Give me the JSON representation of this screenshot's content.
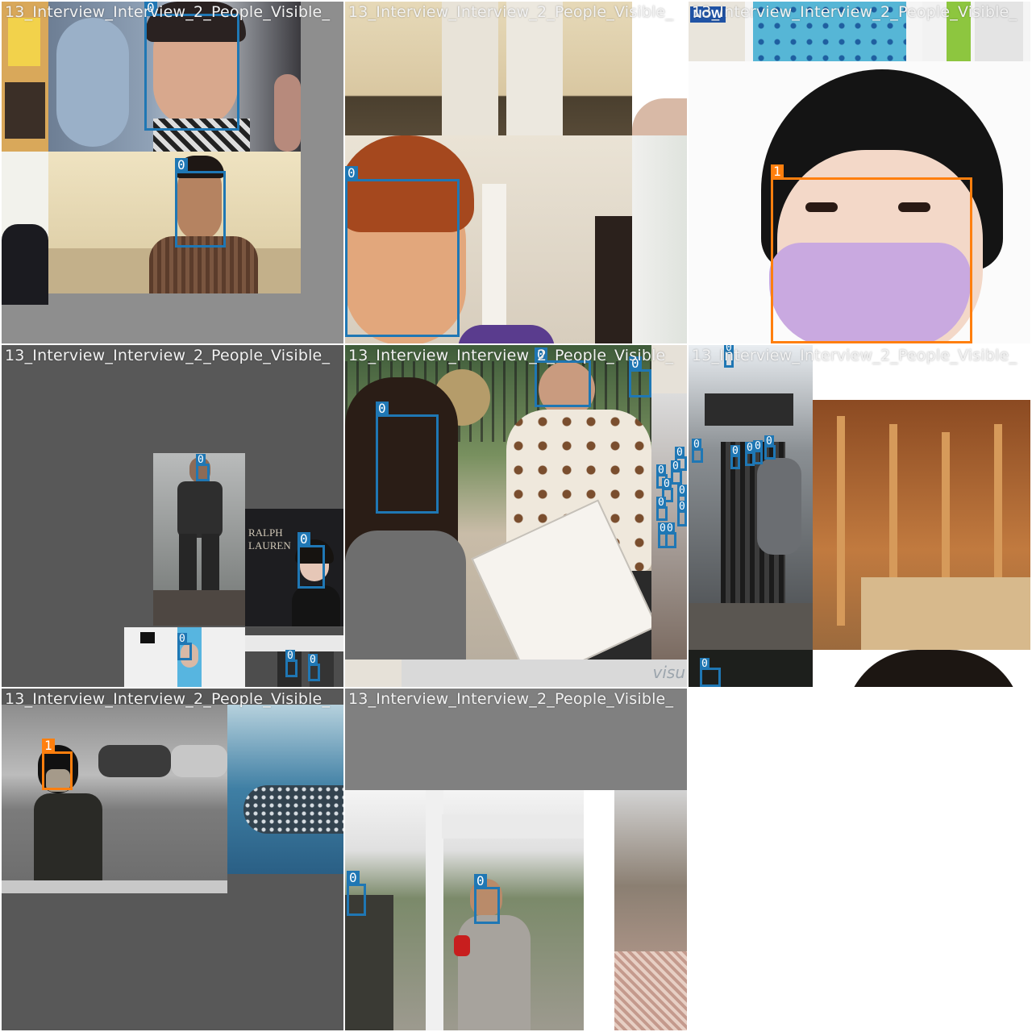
{
  "mosaic": {
    "tile_caption": "13_Interview_Interview_2_People_Visible_",
    "class_colors": {
      "0": "#1f77b4",
      "1": "#ff7f0e"
    },
    "panels": [
      {
        "id": "panel-1",
        "title": "13_Interview_Interview_2_People_Visible_",
        "box_labels": [
          "0",
          "0"
        ]
      },
      {
        "id": "panel-2",
        "title": "13_Interview_Interview_2_People_Visible_",
        "box_labels": [
          "0"
        ]
      },
      {
        "id": "panel-3",
        "title": "13_Interview_Interview_2_People_Visible_",
        "box_labels": [
          "1"
        ]
      },
      {
        "id": "panel-4",
        "title": "13_Interview_Interview_2_People_Visible_",
        "box_labels": [
          "0",
          "0",
          "0",
          "0",
          "0"
        ]
      },
      {
        "id": "panel-5",
        "title": "13_Interview_Interview_2_People_Visible_",
        "box_labels": [
          "0",
          "0",
          "0",
          "0",
          "0",
          "0",
          "0",
          "0",
          "0",
          "0",
          "0",
          "0"
        ]
      },
      {
        "id": "panel-6",
        "title": "13_Interview_Interview_2_People_Visible_",
        "box_labels": [
          "0",
          "0",
          "0",
          "0",
          "0",
          "0",
          "0"
        ]
      },
      {
        "id": "panel-7",
        "title": "13_Interview_Interview_2_People_Visible_",
        "box_labels": [
          "1"
        ]
      },
      {
        "id": "panel-8",
        "title": "13_Interview_Interview_2_People_Visible_",
        "box_labels": [
          "0",
          "0"
        ]
      }
    ],
    "signage": {
      "ralph_lauren": "RALPH LAUREN",
      "now": "NOW",
      "visu": "visu"
    }
  }
}
